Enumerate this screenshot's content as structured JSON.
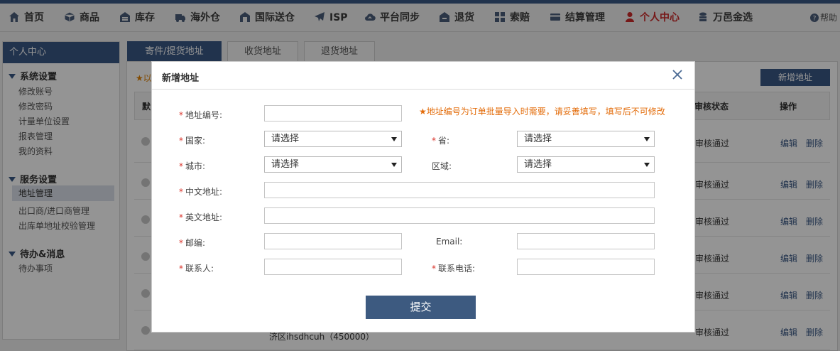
{
  "nav": {
    "items": [
      {
        "label": "首页",
        "icon": "home-icon"
      },
      {
        "label": "商品",
        "icon": "cube-icon"
      },
      {
        "label": "库存",
        "icon": "warehouse-icon"
      },
      {
        "label": "海外仓",
        "icon": "truck-icon"
      },
      {
        "label": "国际送仓",
        "icon": "building-icon"
      },
      {
        "label": "ISP",
        "icon": "plane-icon"
      },
      {
        "label": "平台同步",
        "icon": "cloud-sync-icon"
      },
      {
        "label": "退货",
        "icon": "return-icon"
      },
      {
        "label": "索赔",
        "icon": "grid-icon"
      },
      {
        "label": "结算管理",
        "icon": "card-icon"
      },
      {
        "label": "个人中心",
        "icon": "user-icon"
      },
      {
        "label": "万邑金选",
        "icon": "coins-icon"
      }
    ],
    "active": "个人中心",
    "help": "帮助"
  },
  "sidebar": {
    "title": "个人中心",
    "groups": [
      {
        "title": "系统设置",
        "items": [
          "修改账号",
          "修改密码",
          "计量单位设置",
          "报表管理",
          "我的资料"
        ]
      },
      {
        "title": "服务设置",
        "items": [
          "地址管理",
          "出口商/进口商管理",
          "出库单地址校验管理"
        ]
      },
      {
        "title": "待办&消息",
        "items": [
          "待办事项"
        ]
      }
    ],
    "active_item": "地址管理"
  },
  "tabs": [
    "寄件/提货地址",
    "收货地址",
    "退货地址"
  ],
  "active_tab": "寄件/提货地址",
  "main": {
    "notice_prefix": "以",
    "add_button": "新增地址",
    "columns": {
      "first": "默",
      "status": "审核状态",
      "op": "操作"
    },
    "rows": [
      {
        "status": "审核通过",
        "edit": "编辑",
        "delete": "删除"
      },
      {
        "status": "审核通过",
        "edit": "编辑",
        "delete": "删除"
      },
      {
        "status": "审核通过",
        "edit": "编辑",
        "delete": "删除"
      },
      {
        "status": "审核通过",
        "edit": "编辑",
        "delete": "删除"
      },
      {
        "status": "审核通过",
        "edit": "编辑",
        "delete": "删除"
      },
      {
        "status": "审核通过",
        "edit": "编辑",
        "delete": "删除"
      }
    ],
    "partial_address": "济区ihsdhcuh（450000）"
  },
  "modal": {
    "title": "新增地址",
    "hint": "地址编号为订单批量导入时需要，请妥善填写，填写后不可修改",
    "fields": {
      "code": {
        "label": "地址编号:",
        "value": ""
      },
      "country": {
        "label": "国家:",
        "value": "请选择"
      },
      "province": {
        "label": "省:",
        "value": "请选择"
      },
      "city": {
        "label": "城市:",
        "value": "请选择"
      },
      "district": {
        "label": "区域:",
        "value": "请选择"
      },
      "cn_address": {
        "label": "中文地址:",
        "value": ""
      },
      "en_address": {
        "label": "英文地址:",
        "value": ""
      },
      "zip": {
        "label": "邮编:",
        "value": ""
      },
      "email": {
        "label": "Email:",
        "value": ""
      },
      "contact": {
        "label": "联系人:",
        "value": ""
      },
      "phone": {
        "label": "联系电话:",
        "value": ""
      }
    },
    "submit": "提交"
  },
  "colors": {
    "primary": "#3a5885",
    "active_nav": "#cc2a2a",
    "hint": "#e36c0a",
    "required": "#d9342b"
  }
}
